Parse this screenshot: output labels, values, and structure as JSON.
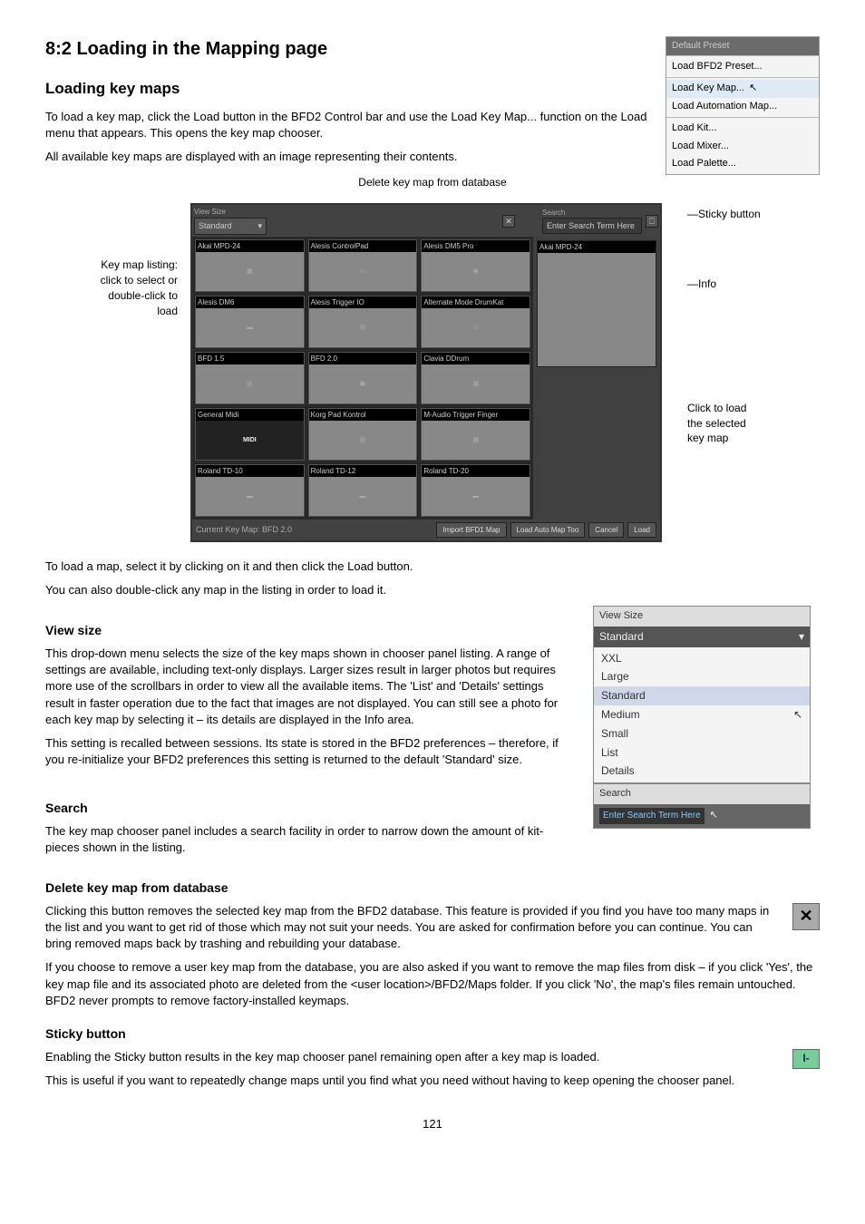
{
  "page": {
    "h1": "8:2 Loading in the Mapping page",
    "h2_loading": "Loading key maps",
    "p_load1": "To load a key map, click the Load button in the BFD2 Control bar and use the Load Key Map... function on the Load menu that appears. This opens the key map chooser.",
    "p_load2": "All available key maps are displayed with an image representing their contents.",
    "delete_callout": "Delete key map from database",
    "left_callout": "Key map listing:\nclick to select or\ndouble-click to\nload",
    "right_callout_sticky": "Sticky button",
    "right_callout_info": "Info",
    "right_callout_loadbtn": "Click to load\nthe selected\nkey map",
    "p_afterdiag1": "To load a map, select it by clicking on it and then click the Load button.",
    "p_afterdiag2": "You can also double-click any map in the listing in order to load it.",
    "h3_viewsize": "View size",
    "p_viewsize1": "This drop-down menu selects the size of the key maps shown in chooser panel listing. A range of settings are available, including text-only displays. Larger sizes result in larger photos but requires more use of the scrollbars in order to view all the available items. The 'List' and 'Details' settings result in faster operation due to the fact that images are not displayed. You can still see a photo for each key map by selecting it – its details are displayed in the Info area.",
    "p_viewsize2": "This setting is recalled between sessions. Its state is stored in the BFD2 preferences – therefore, if you re-initialize your BFD2 preferences this setting is returned to the default 'Standard' size.",
    "h3_search": "Search",
    "p_search": "The key map chooser panel includes a search facility in order to narrow down the amount of kit-pieces shown in the listing.",
    "h3_delete": "Delete key map from database",
    "p_delete1": "Clicking this button removes the selected key map from the BFD2 database. This feature is provided if you find you have too many maps in the list and you want to get rid of those which may not suit your needs. You are asked for confirmation before you can continue. You can bring removed maps back by trashing and rebuilding your database.",
    "p_delete2": "If you choose to remove a user key map from the database, you are also asked if you want to remove the map files from disk – if you click 'Yes', the key map file and its associated photo are deleted from the <user location>/BFD2/Maps folder. If you click 'No', the map's files remain untouched. BFD2 never prompts to remove factory-installed keymaps.",
    "h3_sticky": "Sticky button",
    "p_sticky1": "Enabling the Sticky button results in the key map chooser panel remaining open after a key map is loaded.",
    "p_sticky2": "This is useful if you want to repeatedly change maps until you find what you need without having to keep opening the chooser panel.",
    "pagenum": "121"
  },
  "load_menu": {
    "title": "Default Preset",
    "items": [
      "Load BFD2 Preset...",
      "Load Key Map...",
      "Load Automation Map...",
      "Load Kit...",
      "Load Mixer...",
      "Load Palette..."
    ],
    "highlight_index": 1
  },
  "chooser": {
    "view_size_label": "View Size",
    "view_size_value": "Standard",
    "search_label": "Search",
    "search_placeholder": "Enter Search Term Here",
    "delete_glyph": "✕",
    "sticky_glyph": "⎕",
    "side_thumb": "Akai MPD-24",
    "thumbs": [
      "Akai MPD-24",
      "Alesis ControlPad",
      "Alesis DM5 Pro",
      "Alesis DM6",
      "Alesis Trigger IO",
      "Alternate Mode DrumKat",
      "BFD 1.5",
      "BFD 2.0",
      "Clavia DDrum",
      "General Midi",
      "Korg Pad Kontrol",
      "M-Audio Trigger Finger",
      "Roland TD-10",
      "Roland TD-12",
      "Roland TD-20"
    ],
    "status": "Current Key Map: BFD 2.0",
    "btn_import": "Import BFD1 Map",
    "btn_auto": "Load Auto Map Too",
    "btn_cancel": "Cancel",
    "btn_load": "Load"
  },
  "viewsize_inset": {
    "title": "View Size",
    "selected": "Standard",
    "options": [
      "XXL",
      "Large",
      "Standard",
      "Medium",
      "Small",
      "List",
      "Details"
    ],
    "highlight_index": 2
  },
  "search_inset": {
    "title": "Search",
    "field": "Enter Search Term Here"
  },
  "delete_icon": "✕",
  "sticky_icon": "I-"
}
